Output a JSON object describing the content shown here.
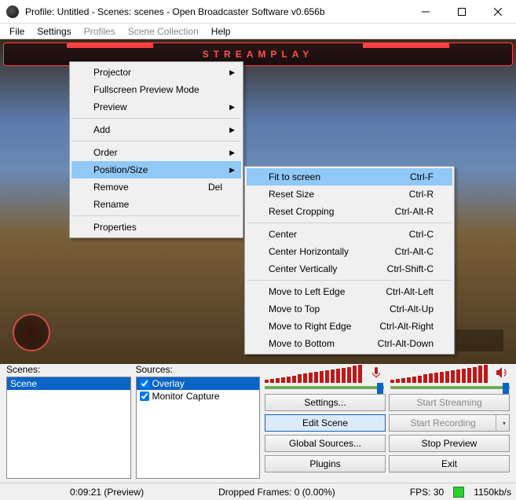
{
  "window": {
    "title": "Profile: Untitled - Scenes: scenes - Open Broadcaster Software v0.656b"
  },
  "menubar": {
    "items": [
      {
        "label": "File",
        "disabled": false
      },
      {
        "label": "Settings",
        "disabled": false
      },
      {
        "label": "Profiles",
        "disabled": true
      },
      {
        "label": "Scene Collection",
        "disabled": true
      },
      {
        "label": "Help",
        "disabled": false
      }
    ]
  },
  "overlay": {
    "brand": "STREAMPLAY"
  },
  "context_menu_1": {
    "items": [
      {
        "label": "Projector",
        "submenu": true
      },
      {
        "label": "Fullscreen Preview Mode"
      },
      {
        "label": "Preview",
        "submenu": true
      },
      {
        "sep": true
      },
      {
        "label": "Add",
        "submenu": true
      },
      {
        "sep": true
      },
      {
        "label": "Order",
        "submenu": true
      },
      {
        "label": "Position/Size",
        "submenu": true,
        "highlighted": true
      },
      {
        "label": "Remove",
        "shortcut": "Del"
      },
      {
        "label": "Rename"
      },
      {
        "sep": true
      },
      {
        "label": "Properties"
      }
    ]
  },
  "context_menu_2": {
    "items": [
      {
        "label": "Fit to screen",
        "shortcut": "Ctrl-F",
        "highlighted": true
      },
      {
        "label": "Reset Size",
        "shortcut": "Ctrl-R"
      },
      {
        "label": "Reset Cropping",
        "shortcut": "Ctrl-Alt-R"
      },
      {
        "sep": true
      },
      {
        "label": "Center",
        "shortcut": "Ctrl-C"
      },
      {
        "label": "Center Horizontally",
        "shortcut": "Ctrl-Alt-C"
      },
      {
        "label": "Center Vertically",
        "shortcut": "Ctrl-Shift-C"
      },
      {
        "sep": true
      },
      {
        "label": "Move to Left Edge",
        "shortcut": "Ctrl-Alt-Left"
      },
      {
        "label": "Move to Top",
        "shortcut": "Ctrl-Alt-Up"
      },
      {
        "label": "Move to Right Edge",
        "shortcut": "Ctrl-Alt-Right"
      },
      {
        "label": "Move to Bottom",
        "shortcut": "Ctrl-Alt-Down"
      }
    ]
  },
  "panels": {
    "scenes_label": "Scenes:",
    "sources_label": "Sources:",
    "scenes": [
      {
        "label": "Scene",
        "selected": true
      }
    ],
    "sources": [
      {
        "label": "Overlay",
        "checked": true,
        "selected": true
      },
      {
        "label": "Monitor Capture",
        "checked": true,
        "selected": false
      }
    ]
  },
  "buttons": {
    "settings": "Settings...",
    "start_streaming": "Start Streaming",
    "edit_scene": "Edit Scene",
    "start_recording": "Start Recording",
    "global_sources": "Global Sources...",
    "stop_preview": "Stop Preview",
    "plugins": "Plugins",
    "exit": "Exit"
  },
  "status": {
    "time": "0:09:21 (Preview)",
    "dropped": "Dropped Frames: 0 (0.00%)",
    "fps": "FPS: 30",
    "bitrate": "1150kb/s"
  }
}
